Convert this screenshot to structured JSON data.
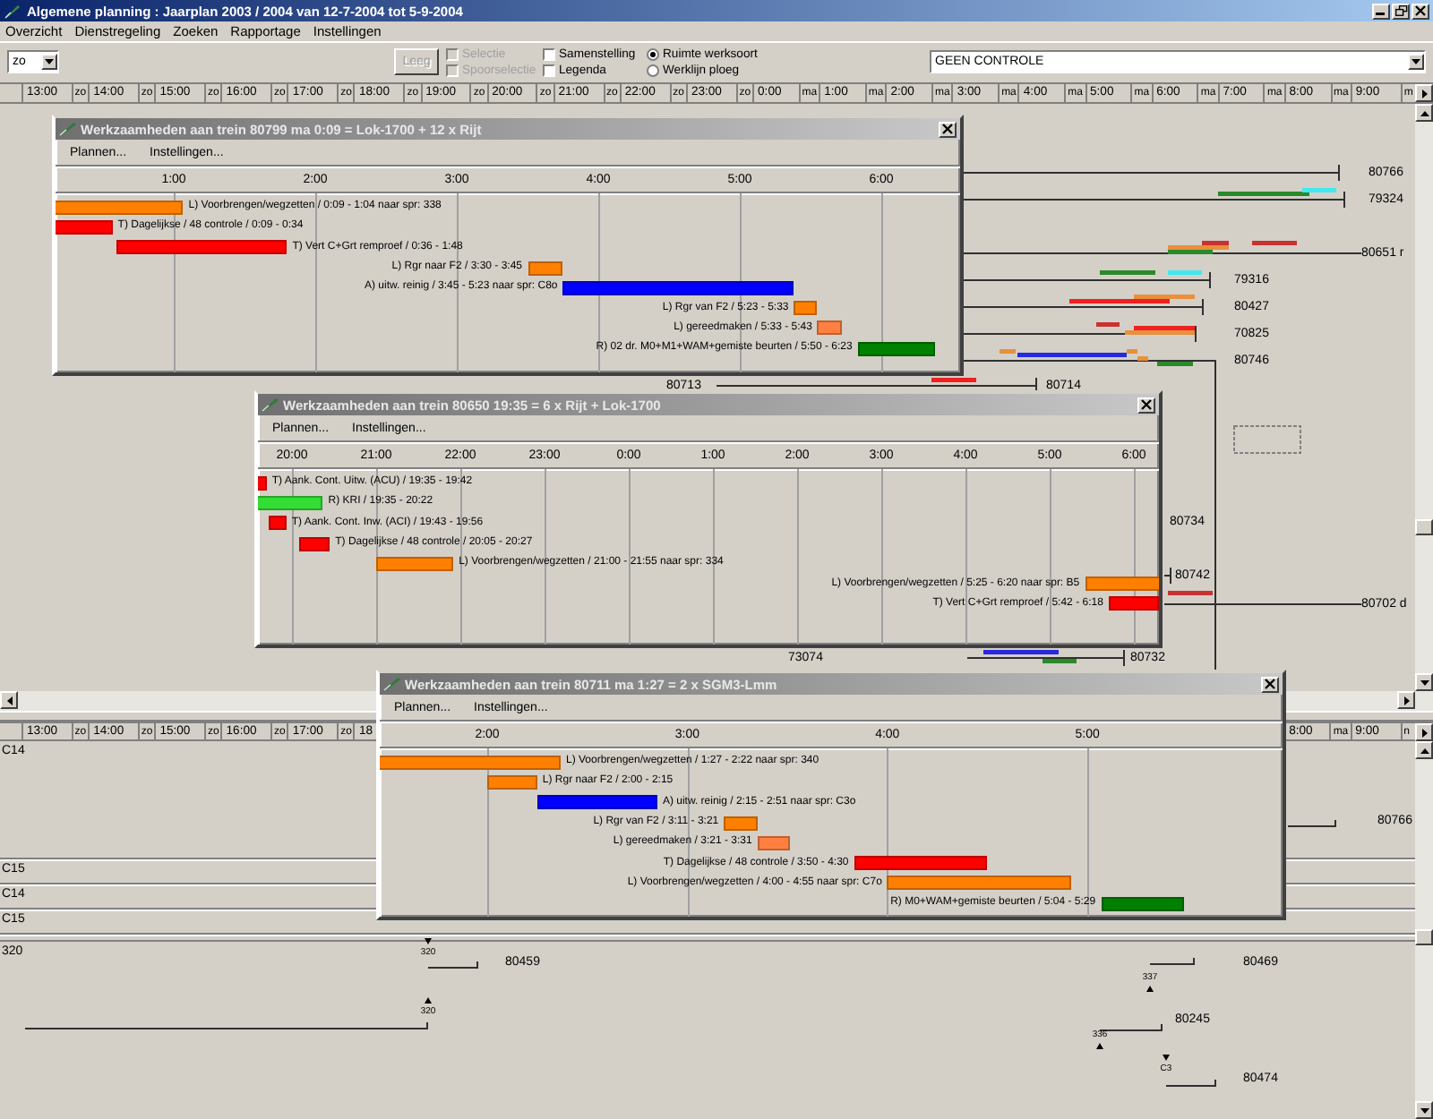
{
  "window": {
    "title": "Algemene planning : Jaarplan 2003 / 2004 van 12-7-2004 tot 5-9-2004"
  },
  "menu": [
    "Overzicht",
    "Dienstregeling",
    "Zoeken",
    "Rapportage",
    "Instellingen"
  ],
  "toolbar": {
    "zoom_select": "zo",
    "clear_button": {
      "label": "Leeg",
      "disabled": true
    },
    "checkboxes": [
      {
        "label": "Selectie",
        "checked": false,
        "disabled": true
      },
      {
        "label": "Spoorselectie",
        "checked": false,
        "disabled": true
      },
      {
        "label": "Samenstelling",
        "checked": false,
        "disabled": false
      },
      {
        "label": "Legenda",
        "checked": false,
        "disabled": false
      }
    ],
    "radios": [
      {
        "label": "Ruimte werksoort",
        "selected": true
      },
      {
        "label": "Werklijn ploeg",
        "selected": false
      }
    ],
    "control_select": "GEEN CONTROLE"
  },
  "top_timeline": [
    {
      "time": "13:00",
      "day": "zo"
    },
    {
      "time": "14:00",
      "day": "zo"
    },
    {
      "time": "15:00",
      "day": "zo"
    },
    {
      "time": "16:00",
      "day": "zo"
    },
    {
      "time": "17:00",
      "day": "zo"
    },
    {
      "time": "18:00",
      "day": "zo"
    },
    {
      "time": "19:00",
      "day": "zo"
    },
    {
      "time": "20:00",
      "day": "zo"
    },
    {
      "time": "21:00",
      "day": "zo"
    },
    {
      "time": "22:00",
      "day": "zo"
    },
    {
      "time": "23:00",
      "day": "zo"
    },
    {
      "time": "0:00",
      "day": "ma"
    },
    {
      "time": "1:00",
      "day": "ma"
    },
    {
      "time": "2:00",
      "day": "ma"
    },
    {
      "time": "3:00",
      "day": "ma"
    },
    {
      "time": "4:00",
      "day": "ma"
    },
    {
      "time": "5:00",
      "day": "ma"
    },
    {
      "time": "6:00",
      "day": "ma"
    },
    {
      "time": "7:00",
      "day": "ma"
    },
    {
      "time": "8:00",
      "day": "ma"
    },
    {
      "time": "9:00",
      "day": "m"
    }
  ],
  "upper_trains": [
    {
      "label": "80766"
    },
    {
      "label": "79324",
      "segments": [
        {
          "color": "#2a8a2a"
        },
        {
          "color": "#40e8f0"
        }
      ]
    },
    {
      "label": "80651 r",
      "segments": [
        {
          "color": "#e8903c"
        },
        {
          "color": "#2a8a2a"
        },
        {
          "color": "#c83232"
        },
        {
          "color": "#c83232"
        }
      ]
    },
    {
      "label": "79316",
      "segments": [
        {
          "color": "#2a8a2a"
        },
        {
          "color": "#40e8f0"
        }
      ]
    },
    {
      "label": "80427",
      "segments": [
        {
          "color": "#f02020"
        },
        {
          "color": "#e8903c"
        }
      ]
    },
    {
      "label": "70825",
      "segments": [
        {
          "color": "#c83232"
        },
        {
          "color": "#f02020"
        },
        {
          "color": "#e8903c"
        }
      ]
    },
    {
      "label": "80746",
      "segments": [
        {
          "color": "#e8903c"
        },
        {
          "color": "#2828e0"
        },
        {
          "color": "#e8903c"
        },
        {
          "color": "#e8903c"
        },
        {
          "color": "#2a8a2a"
        }
      ]
    },
    {
      "label": "80713"
    },
    {
      "label": "80714",
      "segments": [
        {
          "color": "#f02020"
        }
      ]
    },
    {
      "label": "80734"
    },
    {
      "label": "80742"
    },
    {
      "label": "80702 d",
      "segments": [
        {
          "color": "#c83232"
        }
      ]
    },
    {
      "label": "73074"
    },
    {
      "label": "80732",
      "segments": [
        {
          "color": "#2828e0"
        },
        {
          "color": "#2a8a2a"
        }
      ]
    }
  ],
  "bottom_timeline": {
    "left": [
      {
        "time": "13:00",
        "day": "zo"
      },
      {
        "time": "14:00",
        "day": "zo"
      },
      {
        "time": "15:00",
        "day": "zo"
      },
      {
        "time": "16:00",
        "day": "zo"
      },
      {
        "time": "17:00",
        "day": "zo"
      },
      {
        "time": "18"
      }
    ],
    "right": [
      {
        "time": "8:00",
        "day": "ma"
      },
      {
        "time": "9:00",
        "day": "n"
      }
    ]
  },
  "row_labels": [
    "C14",
    "C15",
    "C14",
    "C15",
    "320"
  ],
  "bottom_trains": [
    {
      "label": "80766"
    },
    {
      "label": "80459",
      "markers": [
        "320"
      ]
    },
    {
      "label": "80469",
      "markers": [
        "337"
      ]
    },
    {
      "label": "80245",
      "markers": [
        "320",
        "336"
      ]
    },
    {
      "label": "80474",
      "markers": [
        "C3"
      ]
    }
  ],
  "windows": [
    {
      "title": "Werkzaamheden aan trein 80799 ma 0:09 = Lok-1700 + 12 x Rijt",
      "menu": [
        "Plannen...",
        "Instellingen..."
      ],
      "ticks": [
        "1:00",
        "2:00",
        "3:00",
        "4:00",
        "5:00",
        "6:00"
      ],
      "tasks": [
        {
          "label": "L) Voorbrengen/wegzetten / 0:09 - 1:04 naar spr: 338",
          "color": "#ff8000"
        },
        {
          "label": "T) Dagelijkse / 48 controle / 0:09 - 0:34",
          "color": "#ff0000"
        },
        {
          "label": "T) Vert C+Grt remproef / 0:36 - 1:48",
          "color": "#ff0000"
        },
        {
          "label": "L) Rgr naar F2 / 3:30 - 3:45",
          "color": "#ff8000"
        },
        {
          "label": "A) uitw. reinig / 3:45 - 5:23 naar spr: C8o",
          "color": "#0000ff"
        },
        {
          "label": "L) Rgr van F2 / 5:23 - 5:33",
          "color": "#ff8000"
        },
        {
          "label": "L) gereedmaken / 5:33 - 5:43",
          "color": "#ff8040"
        },
        {
          "label": "R) 02 dr. M0+M1+WAM+gemiste beurten / 5:50 - 6:23",
          "color": "#008000"
        }
      ]
    },
    {
      "title": "Werkzaamheden aan trein 80650 19:35 = 6 x Rijt + Lok-1700",
      "menu": [
        "Plannen...",
        "Instellingen..."
      ],
      "ticks": [
        "20:00",
        "21:00",
        "22:00",
        "23:00",
        "0:00",
        "1:00",
        "2:00",
        "3:00",
        "4:00",
        "5:00",
        "6:00"
      ],
      "tasks": [
        {
          "label": "T) Aank. Cont. Uitw. (ACU) / 19:35 - 19:42",
          "color": "#ff0000"
        },
        {
          "label": "R) KRI / 19:35 - 20:22",
          "color": "#33dd33"
        },
        {
          "label": "T) Aank. Cont. Inw. (ACI) / 19:43 - 19:56",
          "color": "#ff0000"
        },
        {
          "label": "T) Dagelijkse / 48 controle / 20:05 - 20:27",
          "color": "#ff0000"
        },
        {
          "label": "L) Voorbrengen/wegzetten / 21:00 - 21:55 naar spr: 334",
          "color": "#ff8000"
        },
        {
          "label": "L) Voorbrengen/wegzetten / 5:25 - 6:20 naar spr: B5",
          "color": "#ff8000"
        },
        {
          "label": "T) Vert C+Grt remproef / 5:42 - 6:18",
          "color": "#ff0000"
        }
      ]
    },
    {
      "title": "Werkzaamheden aan trein 80711 ma 1:27 = 2 x SGM3-Lmm",
      "menu": [
        "Plannen...",
        "Instellingen..."
      ],
      "ticks": [
        "2:00",
        "3:00",
        "4:00",
        "5:00"
      ],
      "tasks": [
        {
          "label": "L) Voorbrengen/wegzetten / 1:27 - 2:22 naar spr: 340",
          "color": "#ff8000"
        },
        {
          "label": "L) Rgr naar F2 / 2:00 - 2:15",
          "color": "#ff8000"
        },
        {
          "label": "A) uitw. reinig / 2:15 - 2:51 naar spr: C3o",
          "color": "#0000ff"
        },
        {
          "label": "L) Rgr van F2 / 3:11 - 3:21",
          "color": "#ff8000"
        },
        {
          "label": "L) gereedmaken / 3:21 - 3:31",
          "color": "#ff8040"
        },
        {
          "label": "T) Dagelijkse / 48 controle / 3:50 - 4:30",
          "color": "#ff0000"
        },
        {
          "label": "L) Voorbrengen/wegzetten / 4:00 - 4:55 naar spr: C7o",
          "color": "#ff8000"
        },
        {
          "label": "R) M0+WAM+gemiste beurten / 5:04 - 5:29",
          "color": "#008000"
        }
      ]
    }
  ]
}
